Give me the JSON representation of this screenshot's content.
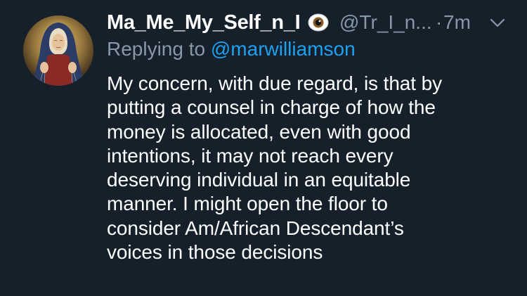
{
  "tweet": {
    "display_name": "Ma_Me_My_Self_n_I",
    "emoji_icon": "eye-emoji-icon",
    "handle": "@Tr_I_n...",
    "separator": "·",
    "time": "7m",
    "reply_prefix": "Replying to ",
    "reply_to": "@marwilliamson",
    "body": "My concern, with due regard, is that by\nputting a counsel in charge of how the\nmoney is allocated, even with good\nintentions, it may not reach every\ndeserving individual in an equitable\nmanner.  I might open the floor to\nconsider Am/African Descendant’s\nvoices in those decisions"
  },
  "colors": {
    "background": "#15202b",
    "primary_text": "#ffffff",
    "secondary_text": "#8899a6",
    "link": "#1da1f2"
  },
  "icons": {
    "avatar": "madonna-painting-avatar",
    "eye": "eye-emoji-icon",
    "menu": "chevron-down-icon"
  }
}
